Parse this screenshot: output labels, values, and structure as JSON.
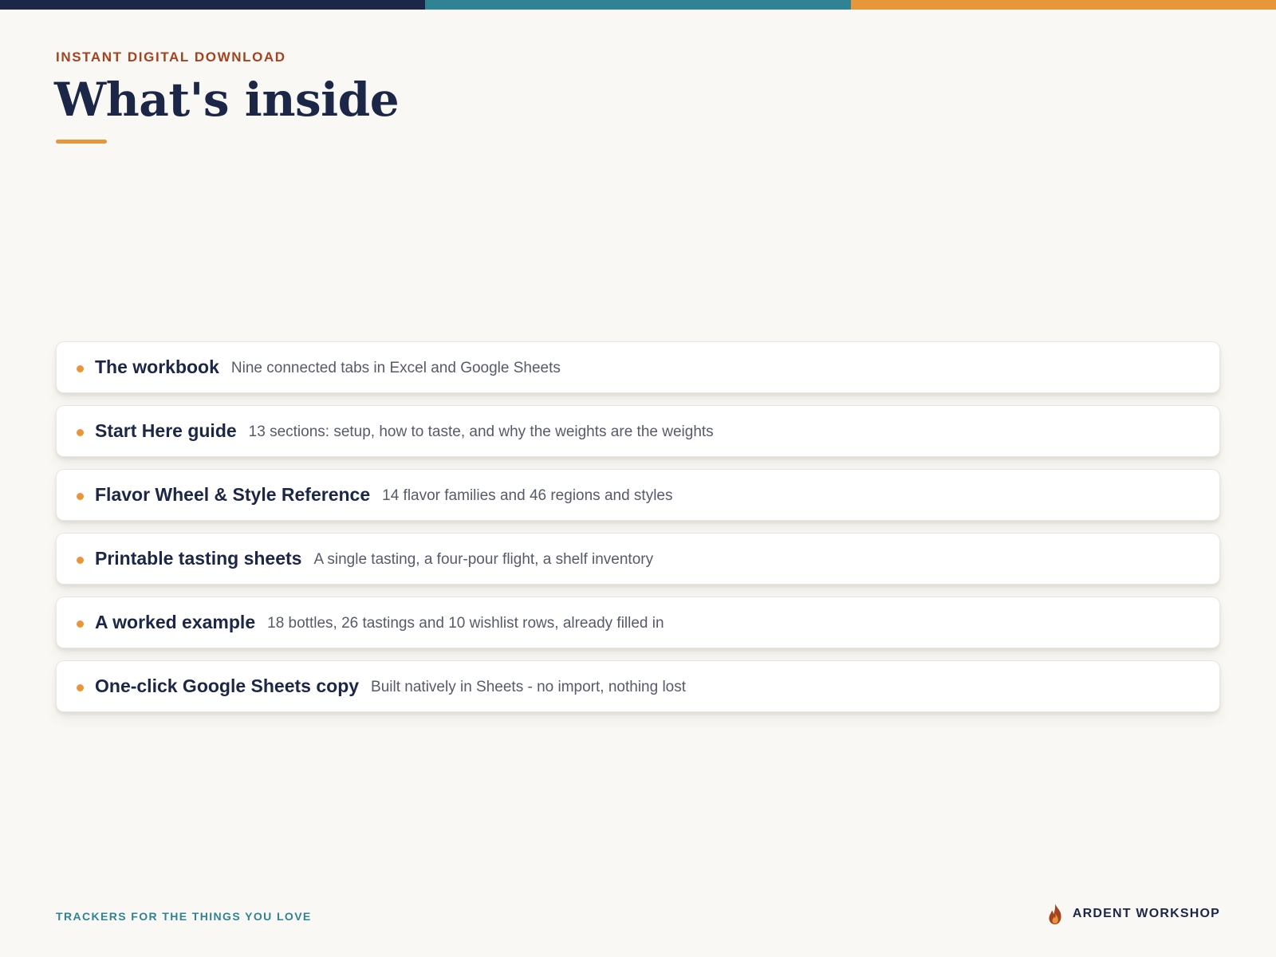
{
  "colors": {
    "background": "#f9f8f4",
    "navy": "#1c2747",
    "teal": "#2f8393",
    "orange": "#e8963a",
    "rust": "#a5421f"
  },
  "header": {
    "eyebrow": "INSTANT DIGITAL DOWNLOAD",
    "title": "What's inside"
  },
  "items": [
    {
      "title": "The workbook",
      "description": "Nine connected tabs in Excel and Google Sheets"
    },
    {
      "title": "Start Here guide",
      "description": "13 sections: setup, how to taste, and why the weights are the weights"
    },
    {
      "title": "Flavor Wheel & Style Reference",
      "description": "14 flavor families and 46 regions and styles"
    },
    {
      "title": "Printable tasting sheets",
      "description": "A single tasting, a four-pour flight, a shelf inventory"
    },
    {
      "title": "A worked example",
      "description": "18 bottles, 26 tastings and 10 wishlist rows, already filled in"
    },
    {
      "title": "One-click Google Sheets copy",
      "description": "Built natively in Sheets - no import, nothing lost"
    }
  ],
  "footer": {
    "tagline": "TRACKERS FOR THE THINGS YOU LOVE",
    "brand": "ARDENT WORKSHOP",
    "brand_icon": "flame-icon"
  }
}
